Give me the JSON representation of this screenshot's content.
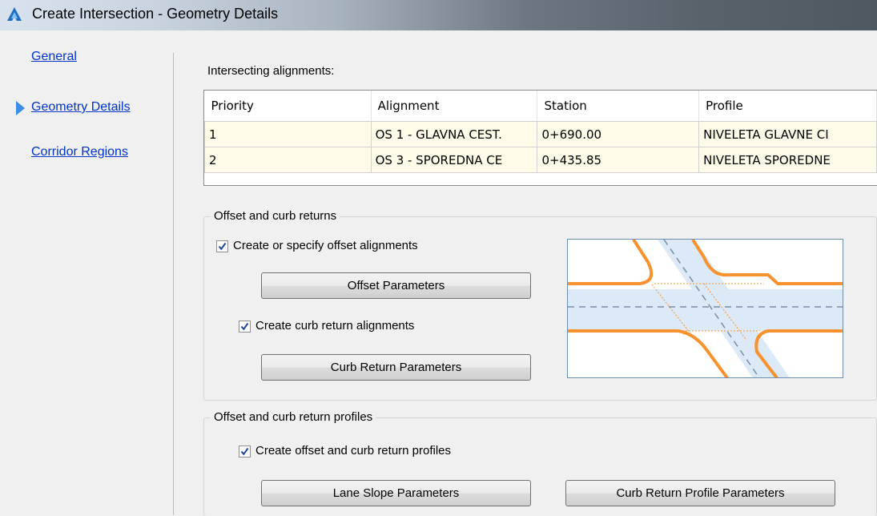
{
  "window": {
    "title": "Create Intersection - Geometry Details",
    "icon": "autocad-civil-icon"
  },
  "nav": {
    "items": [
      {
        "label": "General",
        "active": false
      },
      {
        "label": "Geometry Details",
        "active": true
      },
      {
        "label": "Corridor Regions",
        "active": false
      }
    ]
  },
  "alignments": {
    "label": "Intersecting alignments:",
    "columns": [
      "Priority",
      "Alignment",
      "Station",
      "Profile"
    ],
    "rows": [
      [
        "1",
        "OS 1 - GLAVNA CEST.",
        "0+690.00",
        "NIVELETA GLAVNE CI"
      ],
      [
        "2",
        "OS 3 - SPOREDNA CE",
        "0+435.85",
        "NIVELETA SPOREDNE"
      ]
    ]
  },
  "offset_group": {
    "title": "Offset and curb returns",
    "create_offset_label": "Create or specify offset alignments",
    "create_offset_checked": true,
    "offset_params_button": "Offset Parameters",
    "create_curb_label": "Create curb return alignments",
    "create_curb_checked": true,
    "curb_params_button": "Curb Return Parameters"
  },
  "profiles_group": {
    "title": "Offset and curb return profiles",
    "create_profiles_label": "Create offset and curb return profiles",
    "create_profiles_checked": true,
    "lane_slope_button": "Lane Slope Parameters",
    "curb_profile_button": "Curb Return Profile Parameters"
  },
  "colors": {
    "link": "#0033cc",
    "active_arrow": "#3a8ee8",
    "curb_orange": "#f7922e",
    "road_fill": "#dce9f7",
    "centerline": "#7b8ca6"
  }
}
